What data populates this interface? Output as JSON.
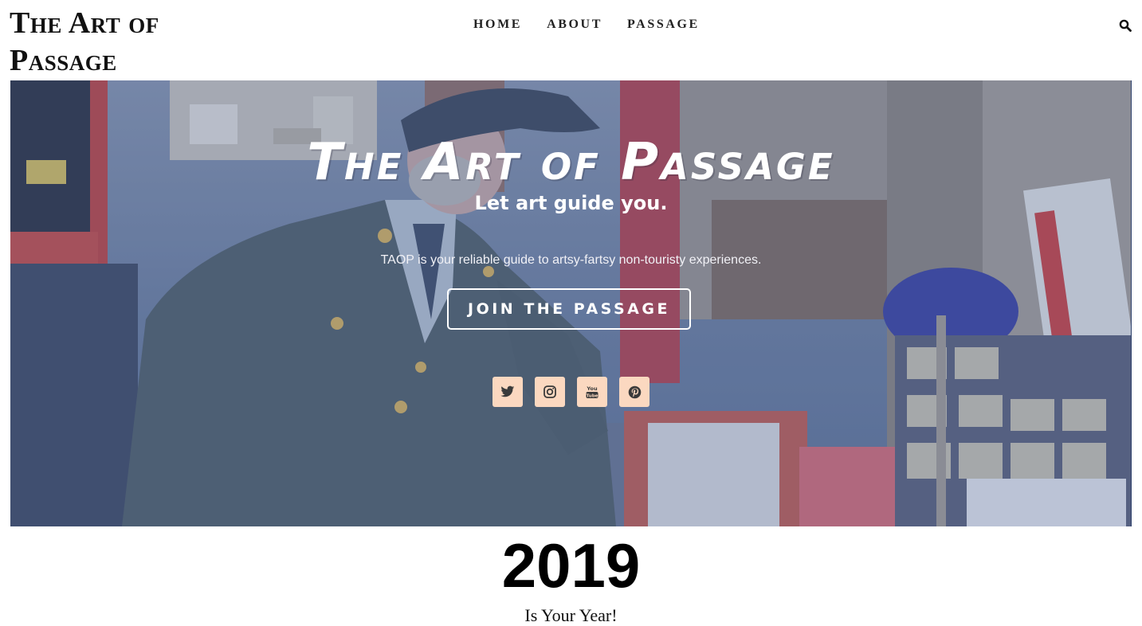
{
  "header": {
    "site_title": "The Art of Passage",
    "nav": [
      "HOME",
      "ABOUT",
      "PASSAGE"
    ],
    "search_icon": "search-icon"
  },
  "hero": {
    "title": "The Art of Passage",
    "tagline": "Let art guide you.",
    "description": "TAOP is your reliable guide to artsy-fartsy non-touristy experiences.",
    "cta_label": "JOIN THE PASSAGE",
    "social": [
      {
        "name": "twitter-icon"
      },
      {
        "name": "instagram-icon"
      },
      {
        "name": "youtube-icon"
      },
      {
        "name": "pinterest-icon"
      }
    ],
    "colors": {
      "overlay": "#48649b",
      "social_bg": "#fbd8c0",
      "accent_red": "#d63b3b"
    }
  },
  "promo": {
    "year": "2019",
    "subtitle": "Is Your Year!"
  }
}
